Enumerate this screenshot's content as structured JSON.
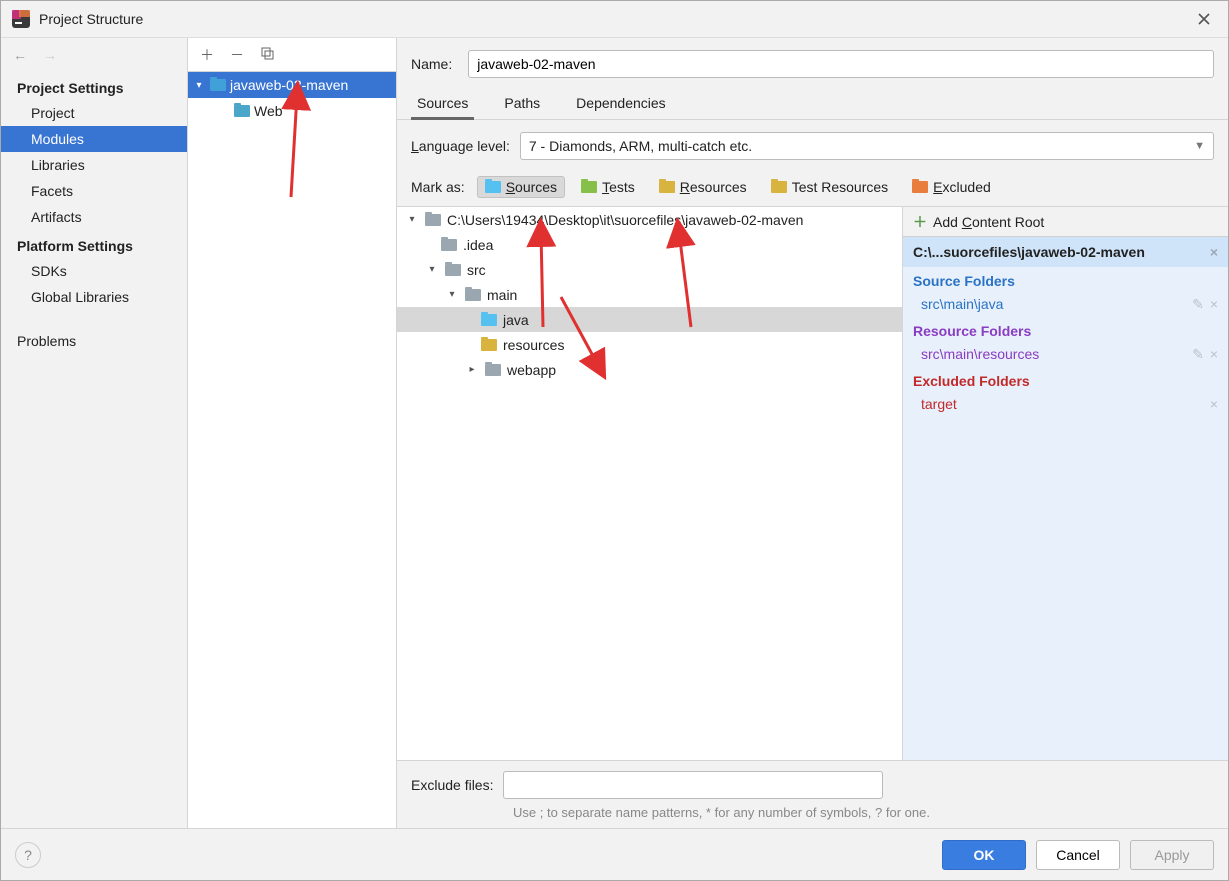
{
  "window": {
    "title": "Project Structure"
  },
  "nav": {
    "headerA": "Project Settings",
    "headerB": "Platform Settings",
    "project": "Project",
    "modules": "Modules",
    "libraries": "Libraries",
    "facets": "Facets",
    "artifacts": "Artifacts",
    "sdks": "SDKs",
    "global_libraries": "Global Libraries",
    "problems": "Problems"
  },
  "module_tree": {
    "root": "javaweb-02-maven",
    "child": "Web"
  },
  "name_label": "Name:",
  "name_value": "javaweb-02-maven",
  "tabs": {
    "sources": "Sources",
    "paths": "Paths",
    "dependencies": "Dependencies"
  },
  "language_level_label": "Language level:",
  "language_level_value": "7 - Diamonds, ARM, multi-catch etc.",
  "mark_as_label": "Mark as:",
  "mark": {
    "sources": "Sources",
    "tests": "Tests",
    "resources": "Resources",
    "test_resources": "Test Resources",
    "excluded": "Excluded"
  },
  "source_tree": {
    "root": "C:\\Users\\19434\\Desktop\\it\\suorcefiles\\javaweb-02-maven",
    "idea": ".idea",
    "src": "src",
    "main": "main",
    "java": "java",
    "resources": "resources",
    "webapp": "webapp"
  },
  "content_root": {
    "add_label": "Add Content Root",
    "path": "C:\\...suorcefiles\\javaweb-02-maven",
    "source_folders_title": "Source Folders",
    "source_folders_entry": "src\\main\\java",
    "resource_folders_title": "Resource Folders",
    "resource_folders_entry": "src\\main\\resources",
    "excluded_folders_title": "Excluded Folders",
    "excluded_folders_entry": "target"
  },
  "exclude_files_label": "Exclude files:",
  "exclude_files_hint": "Use ; to separate name patterns, * for any number of symbols, ? for one.",
  "footer": {
    "ok": "OK",
    "cancel": "Cancel",
    "apply": "Apply"
  }
}
